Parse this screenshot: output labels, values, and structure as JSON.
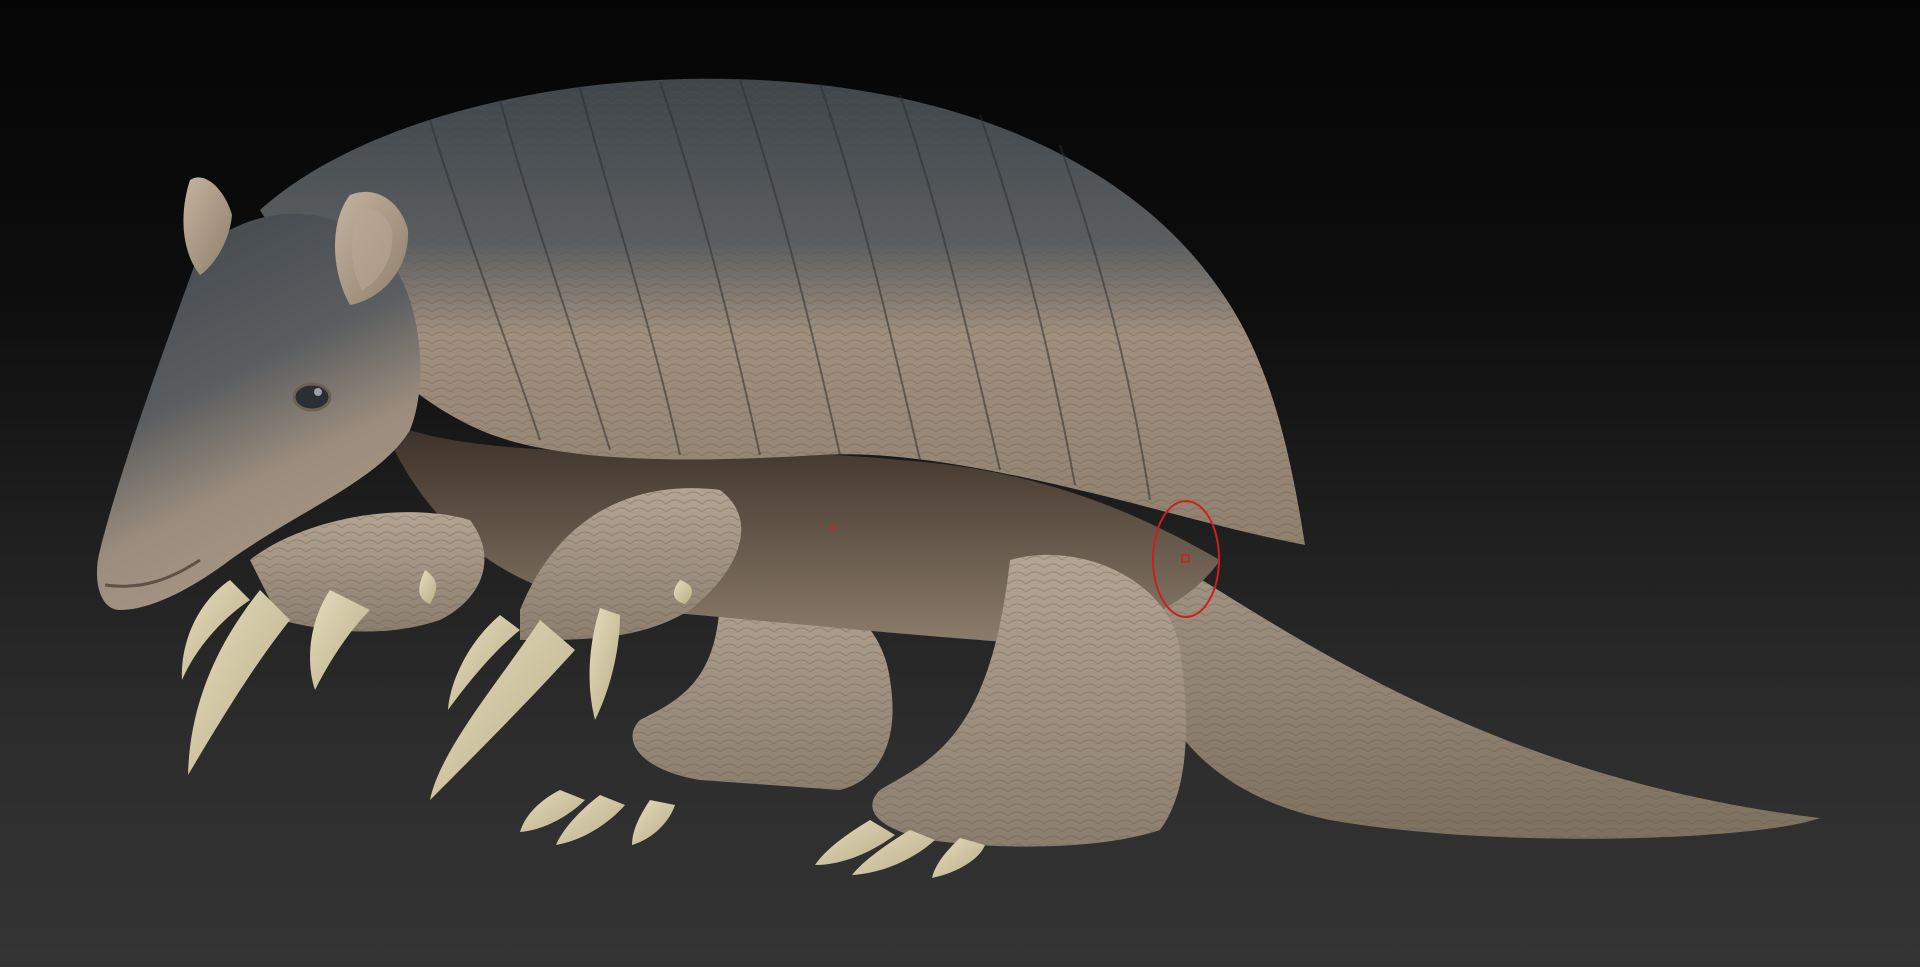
{
  "viewport": {
    "background_top": "#050505",
    "background_bottom": "#343434"
  },
  "model": {
    "subject": "armadillo",
    "shell_color_dark": "#4a4f54",
    "shell_color_light": "#a8988a",
    "skin_color": "#a39585",
    "claw_color": "#d6cba8"
  },
  "brush_cursor": {
    "color": "#cc1f1f"
  }
}
